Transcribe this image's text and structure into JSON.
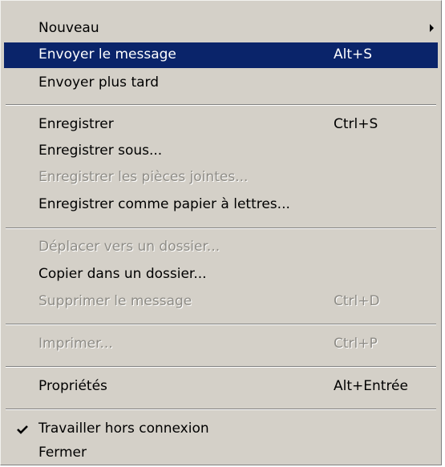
{
  "menu": {
    "items": [
      {
        "label": "Nouveau",
        "shortcut": "",
        "submenu": true
      },
      {
        "label": "Envoyer le message",
        "shortcut": "Alt+S",
        "state": "highlighted"
      },
      {
        "label": "Envoyer plus tard",
        "shortcut": ""
      },
      {
        "label": "Enregistrer",
        "shortcut": "Ctrl+S"
      },
      {
        "label": "Enregistrer sous...",
        "shortcut": ""
      },
      {
        "label": "Enregistrer les pièces jointes...",
        "shortcut": "",
        "state": "disabled"
      },
      {
        "label": "Enregistrer comme papier à lettres...",
        "shortcut": ""
      },
      {
        "label": "Déplacer vers un dossier...",
        "shortcut": "",
        "state": "disabled"
      },
      {
        "label": "Copier dans un dossier...",
        "shortcut": ""
      },
      {
        "label": "Supprimer le message",
        "shortcut": "Ctrl+D",
        "state": "disabled"
      },
      {
        "label": "Imprimer...",
        "shortcut": "Ctrl+P",
        "state": "disabled"
      },
      {
        "label": "Propriétés",
        "shortcut": "Alt+Entrée"
      },
      {
        "label": "Travailler hors connexion",
        "shortcut": "",
        "checked": true,
        "check_icon": "checkmark-icon"
      },
      {
        "label": "Fermer",
        "shortcut": ""
      }
    ]
  },
  "colors": {
    "menu_background": "#d4d0c8",
    "highlight_background": "#0a246a",
    "highlight_text": "#ffffff",
    "disabled_text": "#8e8c86"
  }
}
